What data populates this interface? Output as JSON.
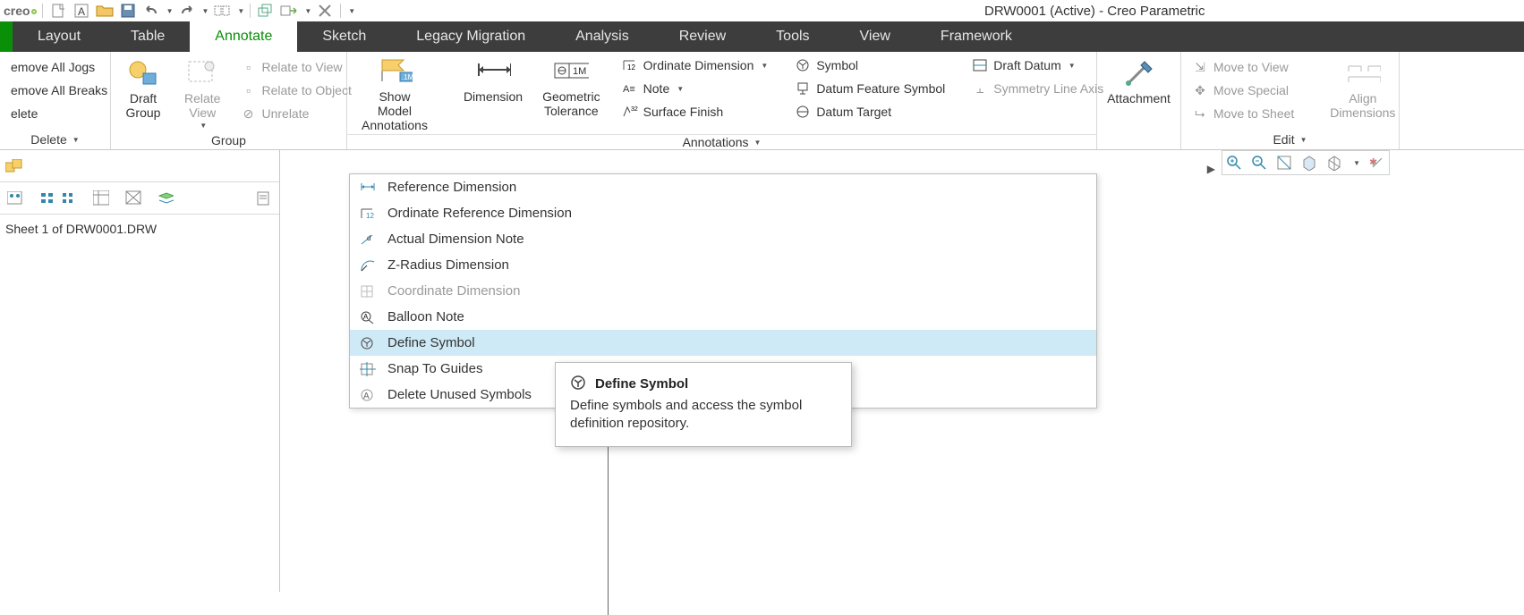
{
  "app": {
    "title": "DRW0001 (Active) - Creo Parametric",
    "logo_text": "creo"
  },
  "tabs": [
    "Layout",
    "Table",
    "Annotate",
    "Sketch",
    "Legacy Migration",
    "Analysis",
    "Review",
    "Tools",
    "View",
    "Framework"
  ],
  "active_tab": "Annotate",
  "ribbon": {
    "delete_group": {
      "remove_all_jogs": "emove All Jogs",
      "remove_all_breaks": "emove All Breaks",
      "delete_small": "elete",
      "caption": "Delete"
    },
    "group_group": {
      "draft_group": "Draft Group",
      "relate_view": "Relate View",
      "relate_to_view": "Relate to View",
      "relate_to_object": "Relate to Object",
      "unrelate": "Unrelate",
      "caption": "Group"
    },
    "annotations_group": {
      "show_model": "Show Model Annotations",
      "dimension": "Dimension",
      "geom_tol": "Geometric Tolerance",
      "ordinate_dim": "Ordinate Dimension",
      "note": "Note",
      "surface_finish": "Surface Finish",
      "symbol": "Symbol",
      "datum_feature": "Datum Feature Symbol",
      "datum_target": "Datum Target",
      "draft_datum": "Draft Datum",
      "symmetry_line": "Symmetry Line Axis",
      "caption": "Annotations"
    },
    "attachment": {
      "label": "Attachment"
    },
    "edit_group": {
      "move_to_view": "Move to View",
      "move_special": "Move Special",
      "move_to_sheet": "Move to Sheet",
      "align_dim": "Align Dimensions",
      "caption": "Edit"
    }
  },
  "tree": {
    "sheet_label": "Sheet 1 of DRW0001.DRW"
  },
  "dropdown": {
    "items": [
      {
        "label": "Reference Dimension",
        "disabled": false
      },
      {
        "label": "Ordinate Reference Dimension",
        "disabled": false
      },
      {
        "label": "Actual Dimension Note",
        "disabled": false
      },
      {
        "label": "Z-Radius Dimension",
        "disabled": false
      },
      {
        "label": "Coordinate Dimension",
        "disabled": true
      },
      {
        "label": "Balloon Note",
        "disabled": false
      },
      {
        "label": "Define Symbol",
        "disabled": false,
        "highlight": true
      },
      {
        "label": "Snap To Guides",
        "disabled": false
      },
      {
        "label": "Delete Unused Symbols",
        "disabled": false
      }
    ]
  },
  "tooltip": {
    "title": "Define Symbol",
    "desc": "Define symbols and access the symbol definition repository."
  }
}
